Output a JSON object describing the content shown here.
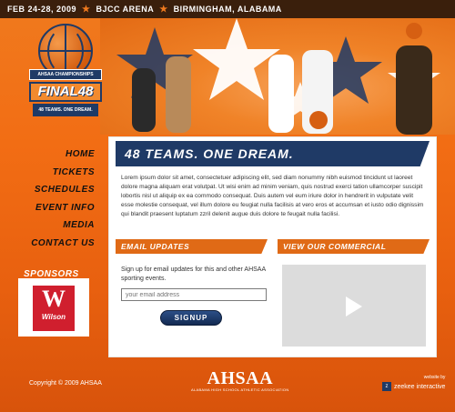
{
  "topbar": {
    "date": "FEB 24-28, 2009",
    "venue": "BJCC ARENA",
    "city": "BIRMINGHAM, ALABAMA",
    "separator": "★"
  },
  "logo": {
    "championship": "AHSAA CHAMPIONSHIPS",
    "title": "FINAL48",
    "tagline": "48 TEAMS. ONE DREAM."
  },
  "nav": {
    "items": [
      "HOME",
      "TICKETS",
      "SCHEDULES",
      "EVENT INFO",
      "MEDIA",
      "CONTACT US"
    ]
  },
  "sponsors": {
    "label": "SPONSORS",
    "logo_text": "Wilson",
    "logo_glyph": "W"
  },
  "main": {
    "headline": "48 TEAMS. ONE DREAM.",
    "body": "Lorem ipsum dolor sit amet, consectetuer adipiscing elit, sed diam nonummy nibh euismod tincidunt ut laoreet dolore magna aliquam erat volutpat. Ut wisi enim ad minim veniam, quis nostrud exerci tation ullamcorper suscipit lobortis nisl ut aliquip ex ea commodo consequat. Duis autem vel eum iriure dolor in hendrerit in vulputate velit esse molestie consequat, vel illum dolore eu feugiat nulla facilisis at vero eros et accumsan et iusto odio dignissim qui blandit praesent luptatum zzril delenit augue duis dolore te feugait nulla facilisi."
  },
  "email": {
    "header": "EMAIL UPDATES",
    "text": "Sign up for email updates for this and other AHSAA sporting events.",
    "placeholder": "your email address",
    "button": "SIGNUP"
  },
  "video": {
    "header": "VIEW OUR COMMERCIAL",
    "icon": "play-icon"
  },
  "footer": {
    "copyright": "Copyright © 2009 AHSAA",
    "org": "AHSAA",
    "org_full": "ALABAMA HIGH SCHOOL ATHLETIC ASSOCIATION",
    "credit_label": "website by",
    "credit_name": "zeekee interactive",
    "credit_badge": "z"
  },
  "colors": {
    "orange": "#f07a1e",
    "navy": "#1f3a66",
    "dark": "#3a1f0c"
  }
}
